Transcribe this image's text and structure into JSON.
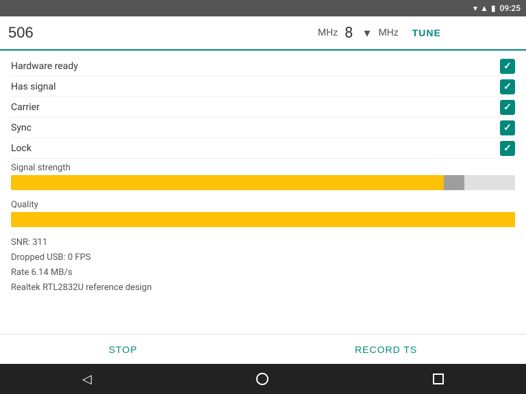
{
  "statusBar": {
    "time": "09:25",
    "wifiIcon": "wifi",
    "batteryIcon": "battery",
    "signalIcon": "signal"
  },
  "toolbar": {
    "freqValue": "506",
    "mhzLabel1": "MHz",
    "channelValue": "8",
    "dropdownIcon": "▾",
    "mhzLabel2": "MHz",
    "tuneLabel": "TUNE"
  },
  "statusItems": [
    {
      "label": "Hardware ready",
      "checked": true
    },
    {
      "label": "Has signal",
      "checked": true
    },
    {
      "label": "Carrier",
      "checked": true
    },
    {
      "label": "Sync",
      "checked": true
    },
    {
      "label": "Lock",
      "checked": true
    }
  ],
  "signalStrength": {
    "label": "Signal strength",
    "fillPercent": 90,
    "grayPercent": 7
  },
  "quality": {
    "label": "Quality",
    "fillPercent": 100
  },
  "stats": {
    "snr": "SNR: 311",
    "dropped": "Dropped USB: 0 FPS",
    "rate": "Rate 6.14 MB/s",
    "device": "Realtek RTL2832U reference design"
  },
  "actions": {
    "stopLabel": "STOP",
    "recordLabel": "RECORD TS"
  },
  "navBar": {
    "backIcon": "◁",
    "homeIcon": "○",
    "recentIcon": "□"
  }
}
